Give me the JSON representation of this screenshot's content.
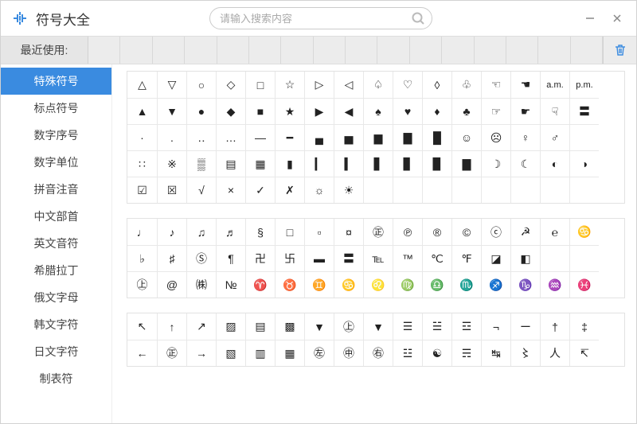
{
  "app": {
    "title": "符号大全"
  },
  "search": {
    "placeholder": "请输入搜索内容"
  },
  "recent": {
    "label": "最近使用:",
    "slots": 16
  },
  "sidebar": {
    "items": [
      {
        "label": "特殊符号",
        "active": true
      },
      {
        "label": "标点符号",
        "active": false
      },
      {
        "label": "数字序号",
        "active": false
      },
      {
        "label": "数字单位",
        "active": false
      },
      {
        "label": "拼音注音",
        "active": false
      },
      {
        "label": "中文部首",
        "active": false
      },
      {
        "label": "英文音符",
        "active": false
      },
      {
        "label": "希腊拉丁",
        "active": false
      },
      {
        "label": "俄文字母",
        "active": false
      },
      {
        "label": "韩文字符",
        "active": false
      },
      {
        "label": "日文字符",
        "active": false
      },
      {
        "label": "制表符",
        "active": false
      }
    ]
  },
  "grids": [
    {
      "rows": [
        [
          "△",
          "▽",
          "○",
          "◇",
          "□",
          "☆",
          "▷",
          "◁",
          "♤",
          "♡",
          "◊",
          "♧",
          "☜",
          "☚",
          "a.m.",
          "p.m."
        ],
        [
          "▲",
          "▼",
          "●",
          "◆",
          "■",
          "★",
          "▶",
          "◀",
          "♠",
          "♥",
          "♦",
          "♣",
          "☞",
          "☛",
          "☟",
          "〓"
        ],
        [
          "·",
          ".",
          "‥",
          "…",
          "—",
          "━",
          "▄",
          "▅",
          "▆",
          "▇",
          "█",
          "☺",
          "☹",
          "♀",
          "♂",
          ""
        ],
        [
          "∷",
          "※",
          "▒",
          "▤",
          "▦",
          "▮",
          "▎",
          "▍",
          "▋",
          "▊",
          "▉",
          "▇",
          "☽",
          "☾",
          "◐",
          "◑"
        ],
        [
          "☑",
          "☒",
          "√",
          "×",
          "✓",
          "✗",
          "☼",
          "☀",
          "",
          "",
          "",
          "",
          "",
          "",
          "",
          ""
        ]
      ]
    },
    {
      "rows": [
        [
          "♩",
          "♪",
          "♫",
          "♬",
          "§",
          "□",
          "▫",
          "¤",
          "㊣",
          "℗",
          "®",
          "©",
          "ⓒ",
          "☭",
          "℮",
          "♋"
        ],
        [
          "♭",
          "♯",
          "Ⓢ",
          "¶",
          "卍",
          "卐",
          "▬",
          "〓",
          "℡",
          "™",
          "℃",
          "℉",
          "◪",
          "◧",
          "",
          ""
        ],
        [
          "㊤",
          "@",
          "㈱",
          "№",
          "♈",
          "♉",
          "♊",
          "♋",
          "♌",
          "♍",
          "♎",
          "♏",
          "♐",
          "♑",
          "♒",
          "♓"
        ]
      ]
    },
    {
      "rows": [
        [
          "↖",
          "↑",
          "↗",
          "▨",
          "▤",
          "▩",
          "▼",
          "㊤",
          "▼",
          "☰",
          "☱",
          "☲",
          "¬",
          "ー",
          "†",
          "‡"
        ],
        [
          "←",
          "㊣",
          "→",
          "▧",
          "▥",
          "▦",
          "㊧",
          "㊥",
          "㊨",
          "☳",
          "☯",
          "☴",
          "↹",
          "〻",
          "人",
          "↸"
        ]
      ]
    }
  ]
}
